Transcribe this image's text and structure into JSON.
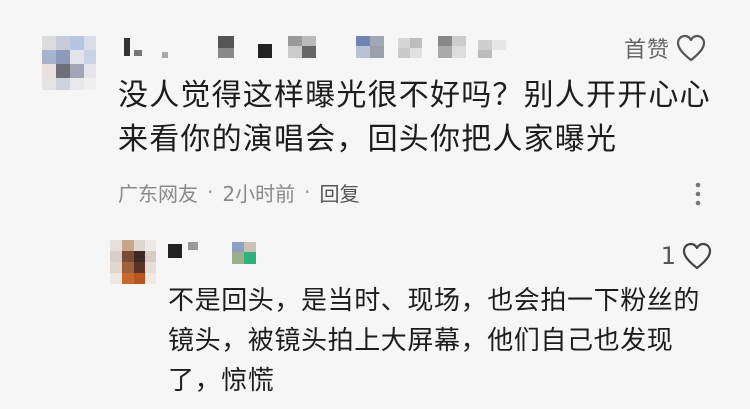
{
  "comment": {
    "like_label": "首赞",
    "text": "没人觉得这样曝光很不好吗？别人开开心心来看你的演唱会，回头你把人家曝光",
    "location": "广东网友",
    "separator": "·",
    "time": "2小时前",
    "reply_label": "回复"
  },
  "reply": {
    "like_count": "1",
    "text": "不是回头，是当时、现场，也会拍一下粉丝的镜头，被镜头拍上大屏幕，他们自己也发现了，惊慌"
  },
  "colors": {
    "background": "#f6f6f6",
    "text": "#1d1d1d",
    "meta": "#8a8a8a"
  }
}
